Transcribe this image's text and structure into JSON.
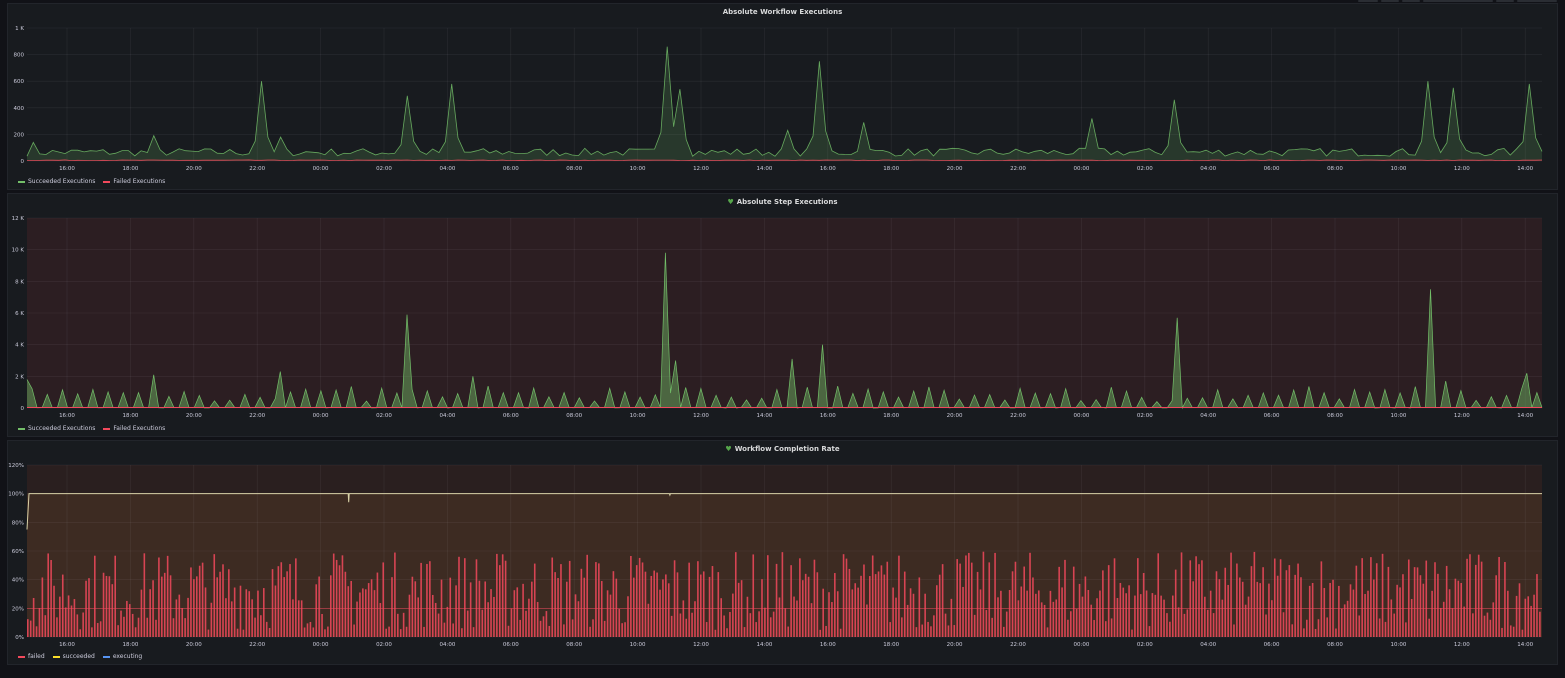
{
  "colors": {
    "succeeded": "#73bf69",
    "failed": "#f2495c",
    "succeeded_rate": "#fade2a",
    "executing": "#5794f2",
    "step_bg": "#2c1e22",
    "rate_bg": "#3d2b22"
  },
  "x_ticks": [
    "16:00",
    "18:00",
    "20:00",
    "22:00",
    "00:00",
    "02:00",
    "04:00",
    "06:00",
    "08:00",
    "10:00",
    "12:00",
    "14:00",
    "16:00",
    "18:00",
    "20:00",
    "22:00",
    "00:00",
    "02:00",
    "04:00",
    "06:00",
    "08:00",
    "10:00",
    "12:00",
    "14:00"
  ],
  "chart_data": [
    {
      "type": "area",
      "title": "Absolute Workflow Executions",
      "y_ticks": [
        "0",
        "200",
        "400",
        "600",
        "800",
        "1 K"
      ],
      "ylim": [
        0,
        1000
      ],
      "grid": true,
      "legend": "bottom-left",
      "series": [
        {
          "name": "Succeeded Executions",
          "base": 60,
          "peaks": [
            [
              0.003,
              140
            ],
            [
              0.082,
              190
            ],
            [
              0.155,
              600
            ],
            [
              0.167,
              180
            ],
            [
              0.25,
              490
            ],
            [
              0.279,
              580
            ],
            [
              0.422,
              860
            ],
            [
              0.433,
              540
            ],
            [
              0.503,
              230
            ],
            [
              0.524,
              750
            ],
            [
              0.552,
              290
            ],
            [
              0.702,
              320
            ],
            [
              0.758,
              460
            ],
            [
              0.925,
              600
            ],
            [
              0.94,
              550
            ],
            [
              0.992,
              580
            ]
          ]
        },
        {
          "name": "Failed Executions",
          "base": 5,
          "peaks": []
        }
      ]
    },
    {
      "type": "area",
      "title": "Absolute Step Executions",
      "y_ticks": [
        "0",
        "2 K",
        "4 K",
        "6 K",
        "8 K",
        "10 K",
        "12 K"
      ],
      "ylim": [
        0,
        12000
      ],
      "grid": true,
      "legend": "bottom-left",
      "series": [
        {
          "name": "Succeeded Executions",
          "base": 1000,
          "peaks": [
            [
              0.0,
              1800
            ],
            [
              0.084,
              2100
            ],
            [
              0.168,
              2300
            ],
            [
              0.252,
              5900
            ],
            [
              0.294,
              2000
            ],
            [
              0.422,
              9800
            ],
            [
              0.428,
              3000
            ],
            [
              0.505,
              3100
            ],
            [
              0.526,
              4000
            ],
            [
              0.758,
              5700
            ],
            [
              0.925,
              7500
            ],
            [
              0.936,
              1700
            ],
            [
              0.99,
              2200
            ]
          ]
        },
        {
          "name": "Failed Executions",
          "base": 30,
          "peaks": []
        }
      ]
    },
    {
      "type": "bar",
      "title": "Workflow Completion Rate",
      "y_ticks": [
        "0%",
        "20%",
        "40%",
        "60%",
        "80%",
        "100%",
        "120%"
      ],
      "ylim": [
        0,
        120
      ],
      "grid": true,
      "legend": "bottom-left",
      "series": [
        {
          "name": "failed",
          "range": [
            5,
            60
          ],
          "base_level": 20
        },
        {
          "name": "succeeded",
          "value": 100,
          "dips": [
            [
              0.0,
              75
            ],
            [
              0.212,
              94
            ],
            [
              0.424,
              99
            ]
          ]
        },
        {
          "name": "executing",
          "value": 0
        }
      ]
    }
  ]
}
